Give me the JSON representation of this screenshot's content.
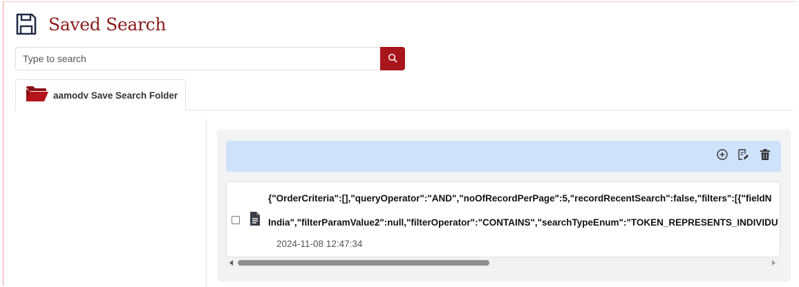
{
  "page": {
    "title": "Saved Search",
    "title_icon": "floppy-disk-icon",
    "brand_color": "#8b1a1a",
    "accent_color": "#a8161c"
  },
  "search": {
    "placeholder": "Type to search",
    "value": "",
    "button_icon": "search-icon"
  },
  "tabs": [
    {
      "label": "aamodv Save Search Folder",
      "icon": "folder-open-icon",
      "active": true
    }
  ],
  "toolbar": {
    "buttons": [
      {
        "name": "add",
        "icon": "plus-circle-icon"
      },
      {
        "name": "edit",
        "icon": "edit-document-icon"
      },
      {
        "name": "delete",
        "icon": "trash-icon"
      }
    ],
    "background": "#cfe2fb"
  },
  "records": [
    {
      "checked": false,
      "icon": "document-icon",
      "line1": "{\"OrderCriteria\":[],\"queryOperator\":\"AND\",\"noOfRecordPerPage\":5,\"recordRecentSearch\":false,\"filters\":[{\"fieldN",
      "line2": "India\",\"filterParamValue2\":null,\"filterOperator\":\"CONTAINS\",\"searchTypeEnum\":\"TOKEN_REPRESENTS_INDIVIDU",
      "timestamp": "2024-11-08 12:47:34"
    }
  ]
}
